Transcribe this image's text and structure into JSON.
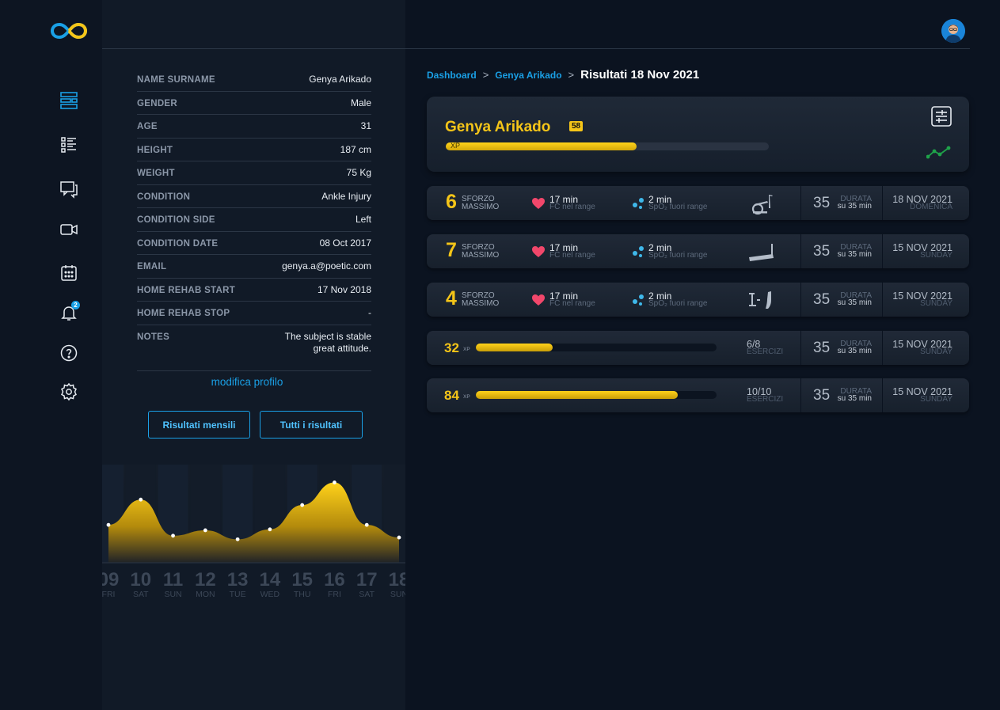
{
  "profile": {
    "rows": [
      {
        "key": "NAME SURNAME",
        "value": "Genya Arikado"
      },
      {
        "key": "GENDER",
        "value": "Male"
      },
      {
        "key": "AGE",
        "value": "31"
      },
      {
        "key": "HEIGHT",
        "value": "187 cm"
      },
      {
        "key": "WEIGHT",
        "value": "75 Kg"
      },
      {
        "key": "CONDITION",
        "value": "Ankle Injury"
      },
      {
        "key": "CONDITION SIDE",
        "value": "Left"
      },
      {
        "key": "CONDITION DATE",
        "value": "08 Oct 2017"
      },
      {
        "key": "EMAIL",
        "value": "genya.a@poetic.com"
      },
      {
        "key": "HOME REHAB START",
        "value": "17 Nov 2018"
      },
      {
        "key": "HOME REHAB STOP",
        "value": "-"
      }
    ],
    "notes_key": "NOTES",
    "notes_line1": "The subject is stable",
    "notes_line2": "great attitude.",
    "edit_link": "modifica profilo",
    "btn_monthly": "Risultati mensili",
    "btn_all": "Tutti i risultati"
  },
  "nav": {
    "notification_count": "2"
  },
  "breadcrumb": {
    "home": "Dashboard",
    "sep": ">",
    "patient": "Genya Arikado",
    "current": "Risultati 18 Nov 2021"
  },
  "hero": {
    "name": "Genya Arikado",
    "level": "58",
    "xp_label": "XP",
    "xp_fraction": 0.59
  },
  "sessions": [
    {
      "effort": "6",
      "effort_l1": "SFORZO",
      "effort_l2": "MASSIMO",
      "hr_main": "17 min",
      "hr_sub": "FC nel range",
      "spo2_main": "2 min",
      "spo2_sub": "SpO₂ fuori range",
      "equipment": "elliptical-icon",
      "dur": "35",
      "dur_lbl": "DURATA",
      "dur_sub": "su 35 min",
      "date": "18 NOV 2021",
      "day": "DOMENICA"
    },
    {
      "effort": "7",
      "effort_l1": "SFORZO",
      "effort_l2": "MASSIMO",
      "hr_main": "17 min",
      "hr_sub": "FC nel range",
      "spo2_main": "2 min",
      "spo2_sub": "SpO₂ fuori range",
      "equipment": "treadmill-icon",
      "dur": "35",
      "dur_lbl": "DURATA",
      "dur_sub": "su 35 min",
      "date": "15 NOV 2021",
      "day": "SUNDAY"
    },
    {
      "effort": "4",
      "effort_l1": "SFORZO",
      "effort_l2": "MASSIMO",
      "hr_main": "17 min",
      "hr_sub": "FC nel range",
      "spo2_main": "2 min",
      "spo2_sub": "SpO₂ fuori range",
      "equipment": "ankle-exercise-icon",
      "dur": "35",
      "dur_lbl": "DURATA",
      "dur_sub": "su 35 min",
      "date": "15 NOV 2021",
      "day": "SUNDAY"
    }
  ],
  "xp_sessions": [
    {
      "xp": "32",
      "xp_lbl": "XP",
      "fraction": 0.32,
      "ex": "6/8",
      "ex_lbl": "ESERCIZI",
      "dur": "35",
      "dur_lbl": "DURATA",
      "dur_sub": "su 35 min",
      "date": "15 NOV 2021",
      "day": "SUNDAY"
    },
    {
      "xp": "84",
      "xp_lbl": "XP",
      "fraction": 0.84,
      "ex": "10/10",
      "ex_lbl": "ESERCIZI",
      "dur": "35",
      "dur_lbl": "DURATA",
      "dur_sub": "su 35 min",
      "date": "15 NOV 2021",
      "day": "SUNDAY"
    }
  ],
  "chart_data": {
    "type": "area",
    "x": [
      "09",
      "10",
      "11",
      "12",
      "13",
      "14",
      "15",
      "16",
      "17",
      "18"
    ],
    "days": [
      "FRI",
      "SAT",
      "SUN",
      "MON",
      "TUE",
      "WED",
      "THU",
      "FRI",
      "SAT",
      "SUN"
    ],
    "values": [
      42,
      70,
      30,
      36,
      26,
      37,
      64,
      89,
      42,
      28
    ],
    "ylim": [
      0,
      100
    ],
    "fill_color": "#f5c518"
  },
  "colors": {
    "accent": "#1aa0e6",
    "gold": "#f5c518",
    "bg": "#0b1320",
    "panel": "#111a27"
  }
}
